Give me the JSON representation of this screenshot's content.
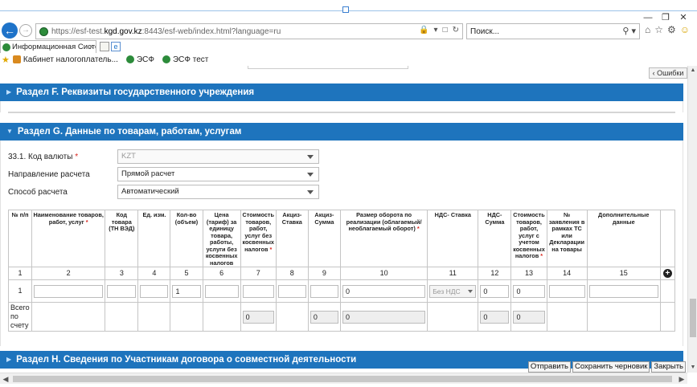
{
  "browser": {
    "url_prefix": "https://esf-test.",
    "url_domain": "kgd.gov.kz",
    "url_suffix": ":8443/esf-web/index.html?language=ru",
    "search_placeholder": "Поиск...",
    "tab_title": "Информационная Систем...",
    "favorites": [
      {
        "label": "Кабинет налогоплатель..."
      },
      {
        "label": "ЭСФ"
      },
      {
        "label": "ЭСФ тест"
      }
    ]
  },
  "page": {
    "errors_button": "Ошибки",
    "section_f_title": "Раздел F. Реквизиты государственного учреждения",
    "section_g_title": "Раздел G. Данные по товарам, работам, услугам",
    "section_h_title": "Раздел H. Сведения по Участникам договора о совместной деятельности",
    "fields": {
      "currency_label": "33.1. Код валюты",
      "currency_required": "*",
      "currency_value": "KZT",
      "direction_label": "Направление расчета",
      "direction_value": "Прямой расчет",
      "method_label": "Способ расчета",
      "method_value": "Автоматический"
    },
    "table": {
      "headers": [
        "№ п/п",
        "Наименование товаров, работ, услуг",
        "Код товара (ТН ВЭД)",
        "Ед. изм.",
        "Кол-во (объем)",
        "Цена (тариф) за единицу товара, работы, услуги без косвенных налогов",
        "Стоимость товаров, работ, услуг без косвенных налогов",
        "Акциз- Ставка",
        "Акциз- Сумма",
        "Размер оборота по реализации (облагаемый/необлагаемый оборот)",
        "НДС- Ставка",
        "НДС- Сумма",
        "Стоимость товаров, работ, услуг с учетом косвенных налогов",
        "№ заявления в рамках ТС или Декларации на товары",
        "Дополнительные данные"
      ],
      "required_mark": "*",
      "column_numbers": [
        "1",
        "2",
        "3",
        "4",
        "5",
        "6",
        "7",
        "8",
        "9",
        "10",
        "11",
        "12",
        "13",
        "14",
        "15"
      ],
      "row": {
        "index": "1",
        "quantity": "1",
        "turnover": "0",
        "vat_rate": "Без НДС",
        "vat_sum": "0",
        "total_with_tax": "0"
      },
      "totals": {
        "label": "Всего по счету",
        "cost_no_tax": "0",
        "excise_sum": "0",
        "turnover": "0",
        "vat_sum": "0",
        "total_with_tax": "0"
      }
    },
    "actions": {
      "send": "Отправить",
      "save_draft": "Сохранить черновик",
      "close": "Закрыть"
    }
  }
}
